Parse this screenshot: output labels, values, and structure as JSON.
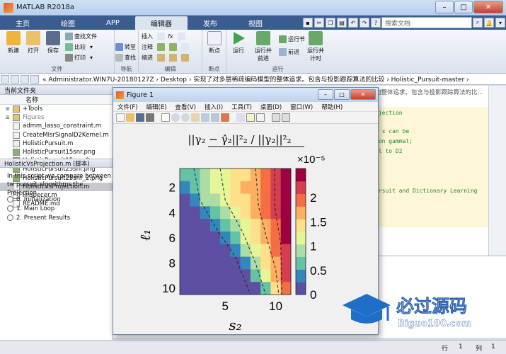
{
  "window": {
    "title": "MATLAB R2018a"
  },
  "tabs": [
    {
      "label": "主页"
    },
    {
      "label": "绘图"
    },
    {
      "label": "APP"
    },
    {
      "label": "编辑器"
    },
    {
      "label": "发布"
    },
    {
      "label": "视图"
    }
  ],
  "search": {
    "placeholder": "搜索文档"
  },
  "ribbon": {
    "file": {
      "new": "新建",
      "open": "打开",
      "save": "保存",
      "find_files": "查找文件",
      "compare": "比较",
      "print": "打印",
      "group": "文件"
    },
    "nav": {
      "goto": "转至",
      "find": "查找",
      "group": "导航"
    },
    "edit": {
      "insert": "插入",
      "comment": "注释",
      "indent": "缩进",
      "group": "编辑"
    },
    "breakpoints": {
      "bp": "断点",
      "group": "断点"
    },
    "run": {
      "run": "运行",
      "run_advance": "运行并\n前进",
      "run_section": "运行节",
      "advance": "前进",
      "run_time": "运行并\n计时",
      "group": "运行"
    }
  },
  "address": {
    "path": "« Administrator.WIN7U-20180127Z › Desktop › 实现了对多层稀疏编码模型的整体追求。包含与投影跟踪算法的比较 › Holistic_Pursuit-master ›"
  },
  "current_folder": {
    "header": "当前文件夹",
    "name_col": "名称",
    "items": [
      {
        "name": "+Tools",
        "type": "folder"
      },
      {
        "name": "Figures",
        "type": "folder",
        "gray": true
      },
      {
        "name": "admm_lasso_constraint.m",
        "type": "m"
      },
      {
        "name": "CreateMlsrSignalD2Kernel.m",
        "type": "m"
      },
      {
        "name": "HolisticPursuit.m",
        "type": "m"
      },
      {
        "name": "HolisticPursuit15snr.png",
        "type": "png"
      },
      {
        "name": "HolisticPursuit15snr_2.png",
        "type": "png"
      },
      {
        "name": "HolisticPursuit25snr.png",
        "type": "png"
      },
      {
        "name": "HolisticPursuit25snr_2.png",
        "type": "png"
      },
      {
        "name": "HolisticVsProjection.m",
        "type": "m",
        "selected": true
      },
      {
        "name": "linspecer.m",
        "type": "m"
      },
      {
        "name": "README.md",
        "type": "md"
      }
    ]
  },
  "details": {
    "header": "HolisticVsProjection.m (脚本)",
    "text": "In this script we compare between tw pursuit algorithms the Projection",
    "outline": [
      "0. Initialization",
      "1. Main Loop",
      "2. Present Results"
    ]
  },
  "editor": {
    "header": "的整体追求。包含与投影跟踪算法的比...",
    "lines": [
      "ojection",
      "l x can be",
      "ion gammal;",
      "ll to D2",
      "ursuit and Dictionary Learning",
      "y"
    ]
  },
  "status": {
    "row_label": "行",
    "row": "1",
    "col_label": "列",
    "col": "1"
  },
  "figure": {
    "title": "Figure 1",
    "menu": [
      "文件(F)",
      "编辑(E)",
      "查看(V)",
      "插入(I)",
      "工具(T)",
      "桌面(D)",
      "窗口(W)",
      "帮助(H)"
    ],
    "plot_title": "||γ₂ − γ̂₂||²₂ / ||γ₂||²₂",
    "xlabel": "s₂",
    "ylabel": "ℓ₁",
    "colorbar_exponent": "×10⁻⁵"
  },
  "chart_data": {
    "type": "heatmap",
    "title": "||γ2 - γ̂2||²₂ / ||γ2||²₂",
    "xlabel": "s2",
    "ylabel": "l1",
    "x_ticks": [
      5,
      10
    ],
    "y_ticks": [
      2,
      4,
      6,
      8,
      10
    ],
    "xlim": [
      0.5,
      11.5
    ],
    "ylim": [
      0.5,
      10.5
    ],
    "colorbar": {
      "ticks": [
        0,
        0.5,
        1,
        1.5,
        2
      ],
      "range": [
        0,
        2.6
      ],
      "exponent": -5
    },
    "colormap": [
      "#5e4fa2",
      "#3288bd",
      "#66c2a5",
      "#abdda4",
      "#e6f598",
      "#fee08b",
      "#fdae61",
      "#f46d43",
      "#d53e4f",
      "#9e0142"
    ],
    "grid": [
      [
        0.55,
        0.75,
        0.95,
        1.1,
        1.25,
        1.45,
        1.55,
        1.75,
        1.95,
        2.15,
        2.55
      ],
      [
        0.35,
        0.7,
        0.9,
        1.05,
        1.2,
        1.4,
        1.6,
        1.8,
        2.0,
        2.2,
        2.5
      ],
      [
        0.0,
        0.5,
        0.8,
        1.0,
        1.15,
        1.35,
        1.55,
        1.75,
        1.95,
        2.15,
        2.45
      ],
      [
        0.0,
        0.0,
        0.45,
        0.75,
        0.95,
        1.2,
        1.4,
        1.65,
        1.9,
        2.1,
        2.4
      ],
      [
        0.0,
        0.0,
        0.0,
        0.35,
        0.7,
        0.95,
        1.25,
        1.5,
        1.8,
        2.05,
        2.4
      ],
      [
        0.0,
        0.0,
        0.0,
        0.0,
        0.3,
        0.75,
        1.05,
        1.35,
        1.7,
        2.0,
        2.35
      ],
      [
        0.0,
        0.0,
        0.0,
        0.0,
        0.0,
        0.35,
        0.85,
        1.2,
        1.55,
        1.9,
        2.3
      ],
      [
        0.0,
        0.0,
        0.0,
        0.0,
        0.0,
        0.0,
        0.45,
        1.0,
        1.4,
        1.8,
        2.2
      ],
      [
        0.0,
        0.0,
        0.0,
        0.0,
        0.0,
        0.0,
        0.0,
        0.55,
        1.15,
        1.65,
        2.15
      ],
      [
        0.0,
        0.0,
        0.0,
        0.0,
        0.0,
        0.0,
        0.0,
        0.0,
        0.6,
        1.4,
        2.0
      ]
    ]
  },
  "watermark": {
    "text": "必过源码",
    "url": "Biguo100.com"
  }
}
